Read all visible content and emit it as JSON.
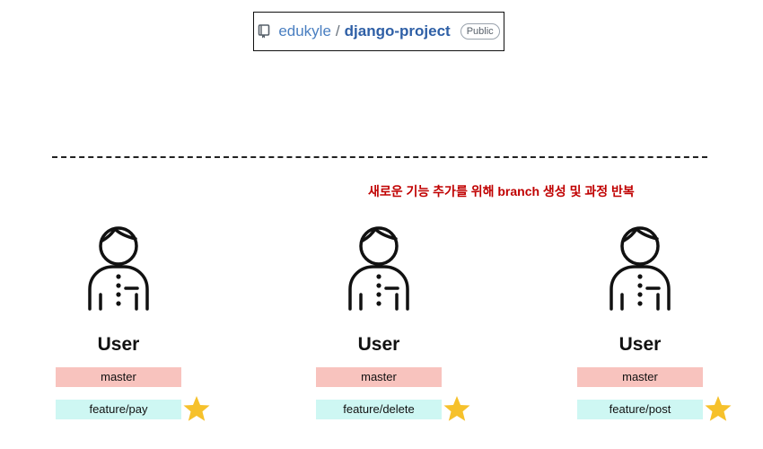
{
  "repo": {
    "owner": "edukyle",
    "separator": "/",
    "name": "django-project",
    "visibility": "Public",
    "icon": "repo-icon"
  },
  "note": "새로운 기능 추가를 위해 branch 생성 및 과정 반복",
  "users": [
    {
      "label": "User",
      "base_branch": "master",
      "feature_branch": "feature/pay"
    },
    {
      "label": "User",
      "base_branch": "master",
      "feature_branch": "feature/delete"
    },
    {
      "label": "User",
      "base_branch": "master",
      "feature_branch": "feature/post"
    }
  ],
  "colors": {
    "master_bg": "#f8c3be",
    "feature_bg": "#cef7f3",
    "note": "#c00000",
    "star": "#f6c12b"
  }
}
